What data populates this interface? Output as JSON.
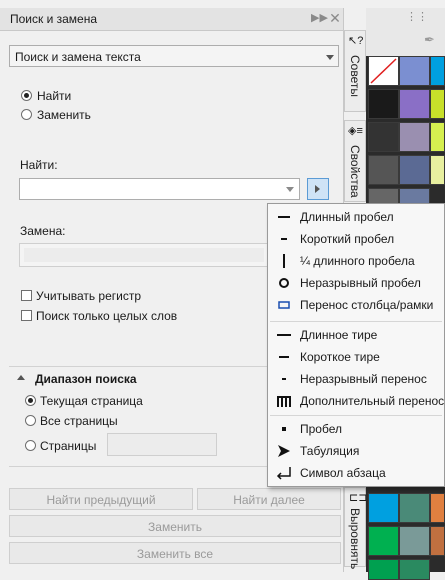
{
  "docker": {
    "title": "Поиск и замена",
    "mode_select": "Поиск и замена текста",
    "radio_find": "Найти",
    "radio_replace": "Заменить",
    "find_label": "Найти:",
    "find_value": "",
    "replace_label": "Замена:",
    "replace_value": "",
    "match_case": "Учитывать регистр",
    "whole_words": "Поиск только целых слов",
    "scope_header": "Диапазон поиска",
    "scope_current": "Текущая страница",
    "scope_all": "Все страницы",
    "scope_pages": "Страницы",
    "pages_value": "",
    "btn_prev": "Найти предыдущий",
    "btn_next": "Найти далее",
    "btn_replace": "Заменить",
    "btn_replace_all": "Заменить все"
  },
  "side_tabs": {
    "hints": "Советы",
    "properties": "Свойства",
    "align": "Выровнять"
  },
  "menu": {
    "items": [
      {
        "label": "Длинный пробел",
        "icon": "em-space-icon"
      },
      {
        "label": "Короткий пробел",
        "icon": "en-space-icon"
      },
      {
        "label": "¼ длинного пробела",
        "icon": "quarter-em-space-icon"
      },
      {
        "label": "Неразрывный пробел",
        "icon": "nonbreaking-space-icon"
      },
      {
        "label": "Перенос столбца/рамки",
        "icon": "column-frame-break-icon"
      },
      {
        "label": "Длинное тире",
        "icon": "em-dash-icon"
      },
      {
        "label": "Короткое тире",
        "icon": "en-dash-icon"
      },
      {
        "label": "Неразрывный перенос",
        "icon": "nonbreaking-hyphen-icon"
      },
      {
        "label": "Дополнительный перенос",
        "icon": "optional-hyphen-icon"
      },
      {
        "label": "Пробел",
        "icon": "space-icon"
      },
      {
        "label": "Табуляция",
        "icon": "tab-icon"
      },
      {
        "label": "Символ абзаца",
        "icon": "paragraph-return-icon"
      }
    ]
  },
  "palette_colors": [
    "#ffffff",
    "#7b8fd1",
    "#1a1a1a",
    "#8a6fc6",
    "#333333",
    "#9a8fb0",
    "#555555",
    "#5b6a94",
    "#00a0e0",
    "#4a8a78",
    "#00b050",
    "#7a9a98",
    "#00a050",
    "#2a8a60",
    "#c8e02a",
    "#d6f050",
    "#e8f0a0",
    "#e08040",
    "#c07040"
  ]
}
